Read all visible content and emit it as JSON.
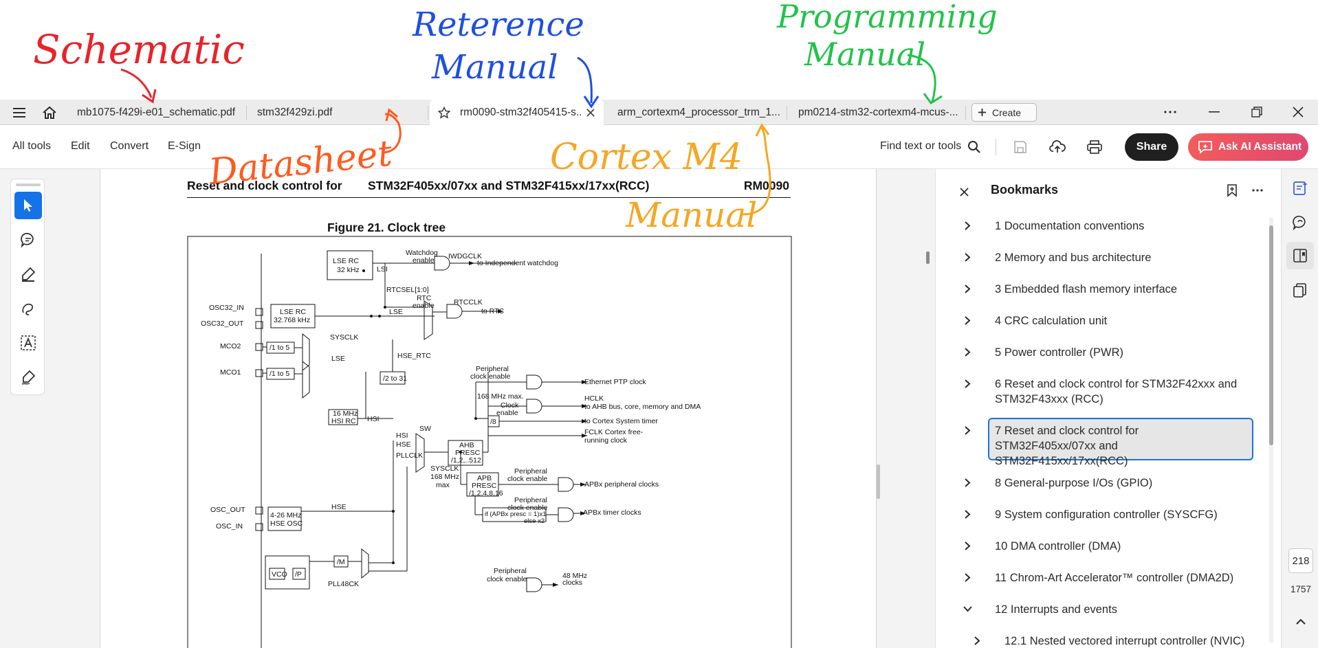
{
  "annotations": {
    "schematic": "Schematic",
    "reference_manual_line1": "Reterence",
    "reference_manual_line2": "Manual",
    "programming_manual_line1": "Programming",
    "programming_manual_line2": "Manual",
    "datasheet": "Datasheet",
    "cortex_m4_line1": "Cortex M4",
    "cortex_m4_line2": "Manual",
    "colors": {
      "schematic": "#e8232a",
      "reference": "#1f4fe0",
      "programming": "#22c24a",
      "datasheet": "#ff5a1f",
      "cortex": "#f5a623"
    }
  },
  "tabs": [
    {
      "label": "mb1075-f429i-e01_schematic.pdf"
    },
    {
      "label": "stm32f429zi.pdf"
    },
    {
      "label": "rm0090-stm32f405415-s...",
      "active": true
    },
    {
      "label": "arm_cortexm4_processor_trm_1..."
    },
    {
      "label": "pm0214-stm32-cortexm4-mcus-..."
    }
  ],
  "tabbar": {
    "create_label": "Create",
    "menu_icon": "hamburger-icon",
    "home_icon": "home-icon"
  },
  "toolbar": {
    "menu": [
      "All tools",
      "Edit",
      "Convert",
      "E-Sign"
    ],
    "find_label": "Find text or tools",
    "share_label": "Share",
    "ai_label": "Ask AI Assistant"
  },
  "document": {
    "header_left": "Reset and clock control for",
    "header_mid": "STM32F405xx/07xx and STM32F415xx/17xx(RCC)",
    "header_right": "RM0090",
    "figure_title": "Figure 21. Clock tree",
    "diagram_labels": {
      "lse_rc": "LSE RC",
      "lse_rc_freq": "32 kHz",
      "watchdog_enable": "Watchdog",
      "watchdog_enable2": "enable",
      "iwdgclk": "IWDGCLK",
      "to_iwdg": "to Independent watchdog",
      "lsi": "LSI",
      "rtcsel": "RTCSEL[1:0]",
      "rtc_enable": "RTC",
      "rtc_enable2": "enable",
      "rtcclk": "RTCCLK",
      "to_rtc": "to RTC",
      "osc32_in": "OSC32_IN",
      "osc32_out": "OSC32_OUT",
      "lse_osc": "LSE RC",
      "lse_osc_freq": "32.768 kHz",
      "lse": "LSE",
      "mco2": "MCO2",
      "mco1": "MCO1",
      "div1to5": "/1 to 5",
      "sysclk": "SYSCLK",
      "lse2": "LSE",
      "hse_rtc": "HSE_RTC",
      "div2to31": "/2 to 31",
      "periph_clk_en": "Peripheral",
      "periph_clk_en2": "clock enable",
      "eth_ptp": "Ethernet PTP clock",
      "max168": "168 MHz max.",
      "clock_enable": "Clock",
      "clock_enable2": "enable",
      "hclk": "HCLK",
      "hclk_desc": "to AHB bus, core, memory and DMA",
      "div8": "/8",
      "cortex_timer": "to Cortex System timer",
      "fclk": "FCLK Cortex free-",
      "fclk2": "running clock",
      "hsi_rc": "16 MHz",
      "hsi_rc2": "HSI RC",
      "hsi": "HSI",
      "sw": "SW",
      "hsi_in": "HSI",
      "hse_in": "HSE",
      "pllclk": "PLLCLK",
      "ahb_presc": "AHB",
      "ahb_presc2": "PRESC",
      "ahb_presc3": "/1,2,..512",
      "sysclk_max": "SYSCLK",
      "sysclk_max2": "168 MHz",
      "sysclk_max3": "max",
      "apb_presc": "APB",
      "apb_presc2": "PRESC",
      "apb_presc3": "/1,2,4,8,16",
      "apb_periph": "APBx peripheral clocks",
      "periph_clk_en3": "Peripheral",
      "periph_clk_en4": "clock enable",
      "apbx_presc_if": "if (APBx presc = 1)x1",
      "apbx_presc_else": "else x2",
      "apb_timer": "APBx timer clocks",
      "osc_out": "OSC_OUT",
      "osc_in": "OSC_IN",
      "hse_osc": "4-26 MHz",
      "hse_osc2": "HSE OSC",
      "hse": "HSE",
      "div_m": "/M",
      "vco": "VCO",
      "div_p": "/P",
      "pll48ck": "PLL48CK",
      "periph_clk_en5": "Peripheral",
      "periph_clk_en6": "clock enable",
      "mhz48": "48 MHz",
      "mhz48_2": "clocks"
    }
  },
  "bookmarks": {
    "title": "Bookmarks",
    "items": [
      {
        "label": "1 Documentation conventions",
        "state": "collapsed"
      },
      {
        "label": "2 Memory and bus architecture",
        "state": "collapsed"
      },
      {
        "label": "3 Embedded flash memory interface",
        "state": "collapsed"
      },
      {
        "label": "4 CRC calculation unit",
        "state": "collapsed"
      },
      {
        "label": "5 Power controller (PWR)",
        "state": "collapsed"
      },
      {
        "label": "6 Reset and clock control for STM32F42xxx and STM32F43xxx (RCC)",
        "state": "collapsed"
      },
      {
        "label": "7 Reset and clock control for STM32F405xx/07xx and STM32F415xx/17xx(RCC)",
        "state": "collapsed",
        "selected": true
      },
      {
        "label": "8 General-purpose I/Os (GPIO)",
        "state": "collapsed"
      },
      {
        "label": "9 System configuration controller (SYSCFG)",
        "state": "collapsed"
      },
      {
        "label": "10 DMA controller (DMA)",
        "state": "collapsed"
      },
      {
        "label": "11 Chrom-Art Accelerator™ controller (DMA2D)",
        "state": "collapsed"
      },
      {
        "label": "12 Interrupts and events",
        "state": "expanded"
      },
      {
        "label": "12.1 Nested vectored interrupt controller (NVIC)",
        "state": "collapsed",
        "child": true
      }
    ]
  },
  "page_nav": {
    "current": "218",
    "total": "1757"
  }
}
